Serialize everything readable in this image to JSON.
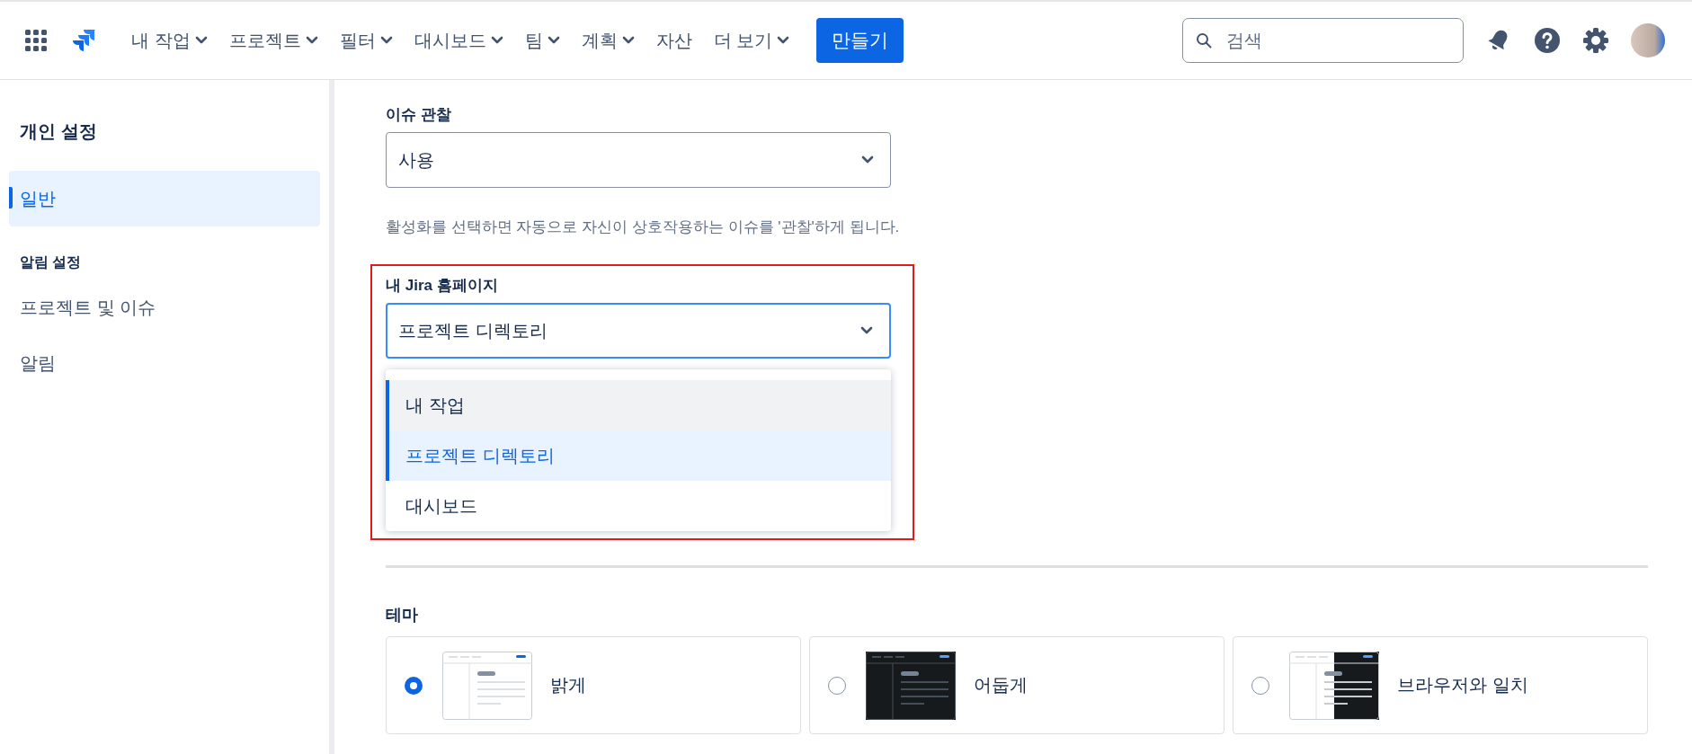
{
  "top_nav": {
    "items": [
      {
        "label": "내 작업",
        "dropdown": true
      },
      {
        "label": "프로젝트",
        "dropdown": true
      },
      {
        "label": "필터",
        "dropdown": true
      },
      {
        "label": "대시보드",
        "dropdown": true
      },
      {
        "label": "팀",
        "dropdown": true
      },
      {
        "label": "계획",
        "dropdown": true
      },
      {
        "label": "자산",
        "dropdown": false
      },
      {
        "label": "더 보기",
        "dropdown": true
      }
    ],
    "create_button": "만들기",
    "search": {
      "placeholder": "검색"
    }
  },
  "sidebar": {
    "title": "개인 설정",
    "items": [
      {
        "label": "일반",
        "selected": true
      }
    ],
    "sections": [
      {
        "heading": "알림 설정",
        "items": [
          {
            "label": "프로젝트 및 이슈",
            "selected": false
          },
          {
            "label": "알림",
            "selected": false
          }
        ]
      }
    ]
  },
  "watch_field": {
    "label": "이슈 관찰",
    "value": "사용",
    "help": "활성화를 선택하면 자동으로 자신이 상호작용하는 이슈를 '관찰'하게 됩니다."
  },
  "homepage_field": {
    "label": "내 Jira 홈페이지",
    "value": "프로젝트 디렉토리",
    "focused": true,
    "highlighted": true,
    "options": [
      {
        "label": "내 작업",
        "hovered": true,
        "selected": false
      },
      {
        "label": "프로젝트 디렉토리",
        "hovered": false,
        "selected": true
      },
      {
        "label": "대시보드",
        "hovered": false,
        "selected": false
      }
    ]
  },
  "theme": {
    "heading": "테마",
    "options": [
      {
        "label": "밝게",
        "kind": "light",
        "selected": true
      },
      {
        "label": "어둡게",
        "kind": "dark",
        "selected": false
      },
      {
        "label": "브라우저와 일치",
        "kind": "match",
        "selected": false
      }
    ]
  }
}
